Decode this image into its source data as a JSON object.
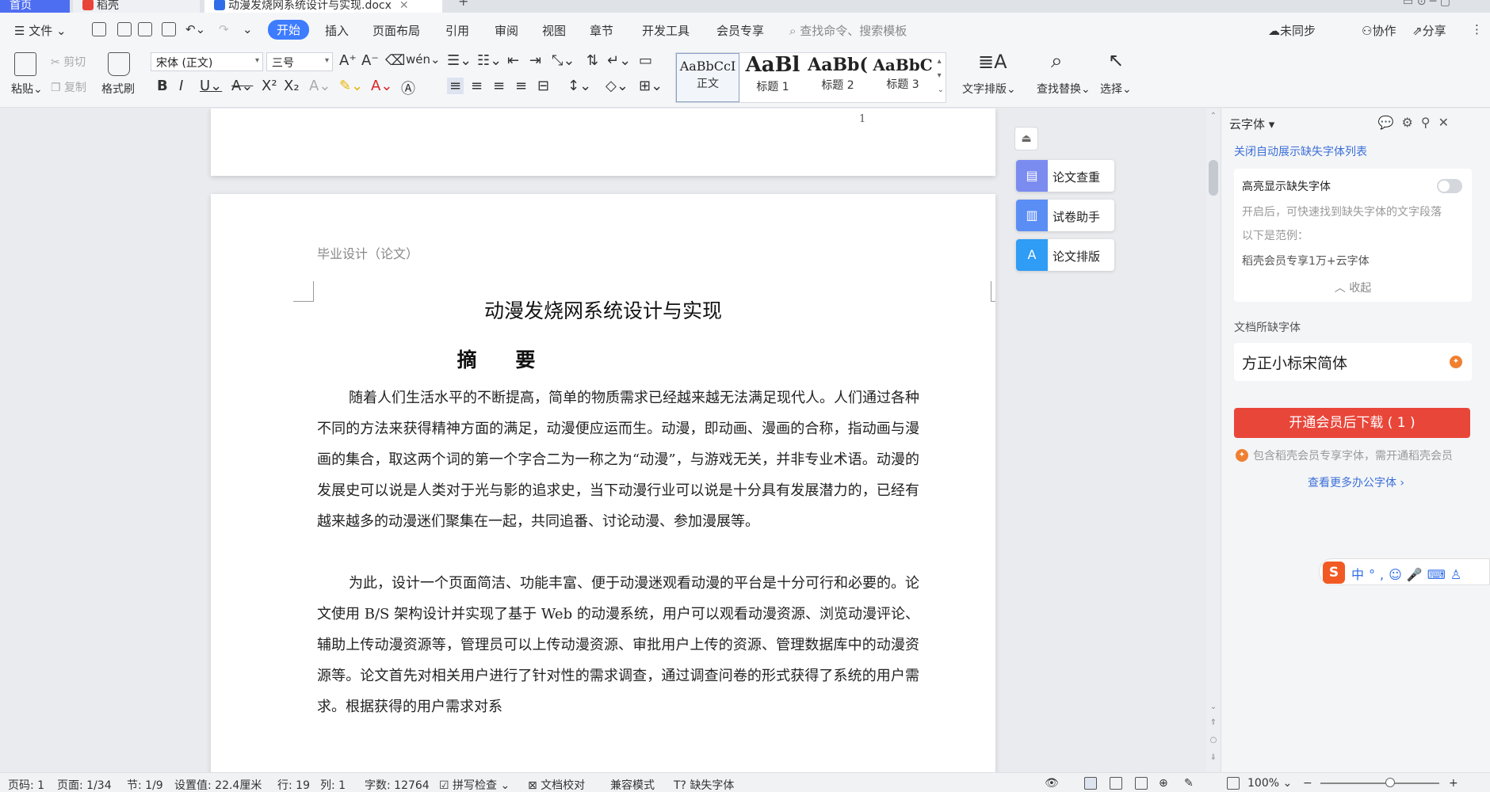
{
  "tabs": [
    {
      "label": "首页"
    },
    {
      "label": "稻壳"
    },
    {
      "label": "动漫发烧网系统设计与实现.docx"
    }
  ],
  "menu": {
    "file": "文件",
    "items": [
      "开始",
      "插入",
      "页面布局",
      "引用",
      "审阅",
      "视图",
      "章节",
      "开发工具",
      "会员专享"
    ],
    "search_placeholder": "查找命令、搜索模板",
    "sync": "未同步",
    "collab": "协作",
    "share": "分享"
  },
  "ribbon": {
    "paste": "粘贴",
    "cut": "剪切",
    "copy": "复制",
    "format_painter": "格式刷",
    "font_name": "宋体 (正文)",
    "font_size": "三号",
    "styles": [
      {
        "sample": "AaBbCcI",
        "name": "正文"
      },
      {
        "sample": "AaBl",
        "name": "标题 1"
      },
      {
        "sample": "AaBb(",
        "name": "标题 2"
      },
      {
        "sample": "AaBbC",
        "name": "标题 3"
      }
    ],
    "text_layout": "文字排版",
    "find_replace": "查找替换",
    "select": "选择"
  },
  "document": {
    "page_number": "1",
    "header": "毕业设计（论文）",
    "title": "动漫发烧网系统设计与实现",
    "abstract_heading": "摘 要",
    "paragraphs": [
      "随着人们生活水平的不断提高，简单的物质需求已经越来越无法满足现代人。人们通过各种不同的方法来获得精神方面的满足，动漫便应运而生。动漫，即动画、漫画的合称，指动画与漫画的集合，取这两个词的第一个字合二为一称之为“动漫”，与游戏无关，并非专业术语。动漫的发展史可以说是人类对于光与影的追求史，当下动漫行业可以说是十分具有发展潜力的，已经有越来越多的动漫迷们聚集在一起，共同追番、讨论动漫、参加漫展等。",
      "为此，设计一个页面简洁、功能丰富、便于动漫迷观看动漫的平台是十分可行和必要的。论文使用 B/S 架构设计并实现了基于 Web 的动漫系统，用户可以观看动漫资源、浏览动漫评论、辅助上传动漫资源等，管理员可以上传动漫资源、审批用户上传的资源、管理数据库中的动漫资源等。论文首先对相关用户进行了针对性的需求调查，通过调查问卷的形式获得了系统的用户需求。根据获得的用户需求对系"
    ]
  },
  "float_tools": [
    "论文查重",
    "试卷助手",
    "论文排版"
  ],
  "panel": {
    "title": "云字体",
    "close_auto_link": "关闭自动展示缺失字体列表",
    "highlight_label": "高亮显示缺失字体",
    "desc1": "开启后，可快速找到缺失字体的文字段落",
    "desc2": "以下是范例：",
    "example": "稻壳会员专享1万+云字体",
    "collapse": "收起",
    "missing_label": "文档所缺字体",
    "missing_font": "方正小标宋简体",
    "cta": "开通会员后下载 ( 1 )",
    "note": "包含稻壳会员专享字体，需开通稻壳会员",
    "more": "查看更多办公字体"
  },
  "ime": {
    "label": "中"
  },
  "status": {
    "page": "页码: 1",
    "pages": "页面: 1/34",
    "section": "节: 1/9",
    "setting": "设置值: 22.4厘米",
    "row": "行: 19",
    "col": "列: 1",
    "words": "字数: 12764",
    "spell": "拼写检查",
    "proof": "文档校对",
    "compat": "兼容模式",
    "missing_font": "缺失字体",
    "zoom": "100%"
  }
}
